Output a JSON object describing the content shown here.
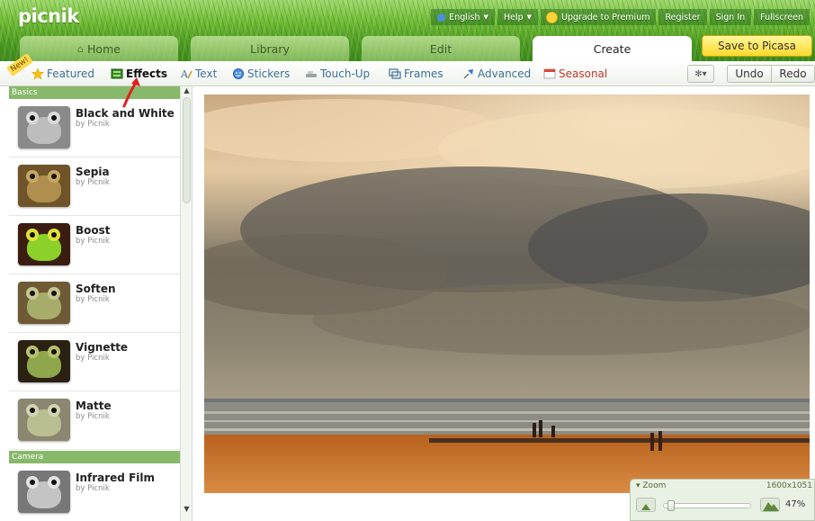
{
  "app": {
    "logo": "picnik"
  },
  "top_nav": {
    "language": "English",
    "help": "Help",
    "upgrade": "Upgrade to Premium",
    "register": "Register",
    "sign_in": "Sign In",
    "fullscreen": "Fullscreen"
  },
  "tabs": [
    {
      "label": "Home",
      "active": false
    },
    {
      "label": "Library",
      "active": false
    },
    {
      "label": "Edit",
      "active": false
    },
    {
      "label": "Create",
      "active": true
    }
  ],
  "save_button": "Save to Picasa",
  "toolbar": {
    "new_badge": "New!",
    "featured": "Featured",
    "effects": "Effects",
    "text": "Text",
    "stickers": "Stickers",
    "touch_up": "Touch-Up",
    "frames": "Frames",
    "advanced": "Advanced",
    "seasonal": "Seasonal",
    "gear_menu": "✻▾",
    "undo": "Undo",
    "redo": "Redo"
  },
  "sidebar": {
    "sections": [
      {
        "title": "Basics"
      },
      {
        "title": "Camera"
      }
    ],
    "effects": [
      {
        "name": "Black and White",
        "by": "by Picnik",
        "section": "Basics",
        "colors": {
          "bg": "#8a8a8a",
          "body": "#bdbdbd",
          "eye": "#dcdcdc"
        }
      },
      {
        "name": "Sepia",
        "by": "by Picnik",
        "section": "Basics",
        "colors": {
          "bg": "#6e5428",
          "body": "#b08f4e",
          "eye": "#c8a762"
        }
      },
      {
        "name": "Boost",
        "by": "by Picnik",
        "section": "Basics",
        "colors": {
          "bg": "#3a1d10",
          "body": "#8bd12a",
          "eye": "#e1e23a"
        }
      },
      {
        "name": "Soften",
        "by": "by Picnik",
        "section": "Basics",
        "colors": {
          "bg": "#6e5a35",
          "body": "#a6ad6a",
          "eye": "#c7c890"
        }
      },
      {
        "name": "Vignette",
        "by": "by Picnik",
        "section": "Basics",
        "colors": {
          "bg": "#2b2112",
          "body": "#8ea64c",
          "eye": "#b9c26a"
        }
      },
      {
        "name": "Matte",
        "by": "by Picnik",
        "section": "Basics",
        "colors": {
          "bg": "#8b866f",
          "body": "#b9bf90",
          "eye": "#d2d4b0"
        }
      },
      {
        "name": "Infrared Film",
        "by": "by Picnik",
        "section": "Camera",
        "colors": {
          "bg": "#777777",
          "body": "#c4c4c4",
          "eye": "#e3e3e3"
        }
      }
    ]
  },
  "zoom": {
    "label": "Zoom",
    "dimensions": "1600x1051",
    "percent": "47%",
    "slider_fraction": 0.04
  },
  "colors": {
    "header_green": "#5aa82a",
    "tab_active": "#ffffff",
    "save_yellow": "#ffd82e",
    "toolbar_link": "#3f6f99",
    "section_header": "#88b86a",
    "arrow_red": "#e02020"
  }
}
